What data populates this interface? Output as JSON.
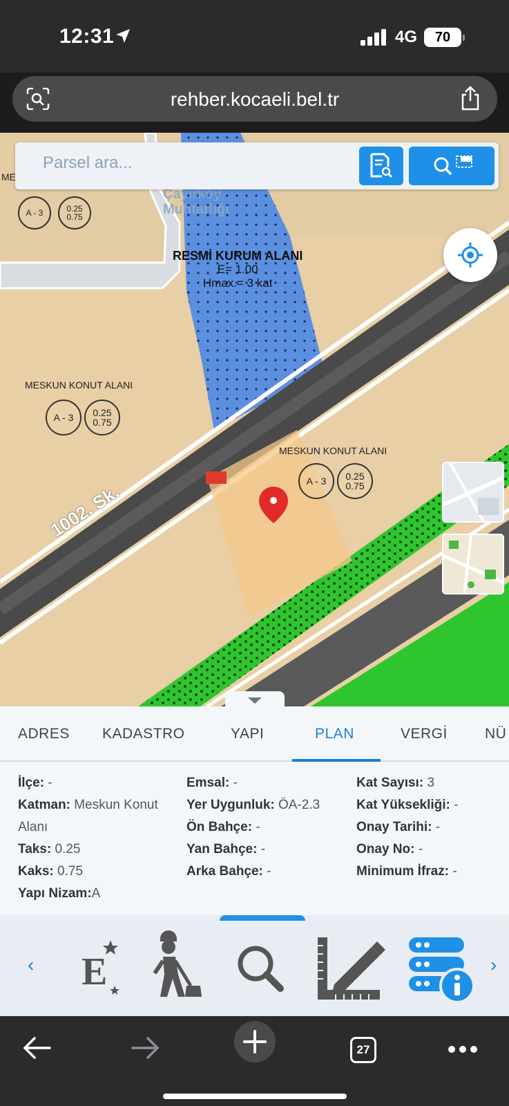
{
  "status": {
    "time": "12:31",
    "network": "4G",
    "battery": "70"
  },
  "browser": {
    "url": "rehber.kocaeli.bel.tr",
    "tab_count": "27"
  },
  "search": {
    "placeholder": "Parsel ara..."
  },
  "map": {
    "poi": [
      "Çayırköy",
      "Muhtarlığı"
    ],
    "plan_area_title": "RESMİ KURUM ALANI",
    "plan_area_e": "E= 1.00",
    "plan_area_hmax": "Hmax.= 3 kat",
    "label_left": "MESKUN KONUT ALANI",
    "label_right": "MESKUN KONUT ALANI",
    "label_top_left": "MES",
    "street": "1002. Sk.",
    "badge_a3": "A - 3",
    "badge_ratio_top": "0.25",
    "badge_ratio_bottom": "0.75",
    "colors": {
      "residential": "#e8cfa6",
      "institution": "#5b8fe0",
      "green": "#2fc52f",
      "road": "#4a4a4a"
    }
  },
  "tabs": [
    "ADRES",
    "KADASTRO",
    "YAPI",
    "PLAN",
    "VERGİ",
    "NÜ"
  ],
  "active_tab": "PLAN",
  "plan": {
    "ilce": {
      "label": "İlçe:",
      "value": "-"
    },
    "katman": {
      "label": "Katman:",
      "value": "Meskun Konut",
      "value2": "Alanı"
    },
    "taks": {
      "label": "Taks:",
      "value": "0.25"
    },
    "kaks": {
      "label": "Kaks:",
      "value": "0.75"
    },
    "yapi_nizam": {
      "label": "Yapı Nizam:",
      "value": "A"
    },
    "emsal": {
      "label": "Emsal:",
      "value": "-"
    },
    "yer_uygunluk": {
      "label": "Yer Uygunluk:",
      "value": "ÖA-2.3"
    },
    "on_bahce": {
      "label": "Ön Bahçe:",
      "value": "-"
    },
    "yan_bahce": {
      "label": "Yan Bahçe:",
      "value": "-"
    },
    "arka_bahce": {
      "label": "Arka Bahçe:",
      "value": "-"
    },
    "kat_sayisi": {
      "label": "Kat Sayısı:",
      "value": "3"
    },
    "kat_yuksekligi": {
      "label": "Kat Yüksekliği:",
      "value": "-"
    },
    "onay_tarihi": {
      "label": "Onay Tarihi:",
      "value": "-"
    },
    "onay_no": {
      "label": "Onay No:",
      "value": "-"
    },
    "minimum_ifraz": {
      "label": "Minimum İfraz:",
      "value": "-"
    }
  },
  "toolbar_icons": [
    "e-belediye-icon",
    "construction-worker-icon",
    "search-icon",
    "ruler-pencil-icon",
    "server-info-icon"
  ]
}
